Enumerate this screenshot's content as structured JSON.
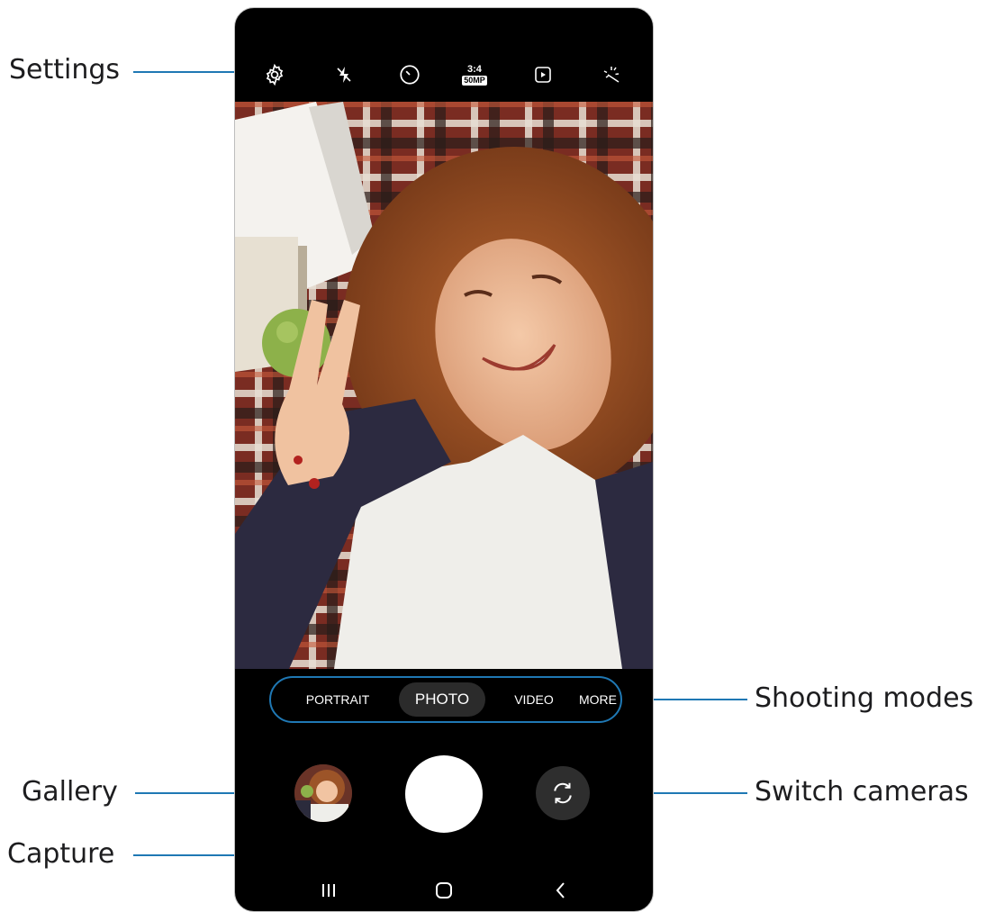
{
  "callouts": {
    "settings": "Settings",
    "shooting_modes": "Shooting modes",
    "gallery": "Gallery",
    "switch_cameras": "Switch cameras",
    "capture": "Capture"
  },
  "top_bar": {
    "icons": [
      "gear-icon",
      "flash-off-icon",
      "timer-icon",
      "ratio-icon",
      "motion-photo-icon",
      "effects-icon"
    ],
    "ratio_top": "3:4",
    "ratio_bottom": "50MP"
  },
  "modes": {
    "portrait": "PORTRAIT",
    "photo": "PHOTO",
    "video": "VIDEO",
    "more": "MORE",
    "selected": "PHOTO"
  },
  "nav": {
    "icons": [
      "recents-icon",
      "home-icon",
      "back-icon"
    ]
  },
  "colors": {
    "callout_line": "#1f78b4",
    "phone_bg": "#000000",
    "shutter": "#ffffff"
  }
}
